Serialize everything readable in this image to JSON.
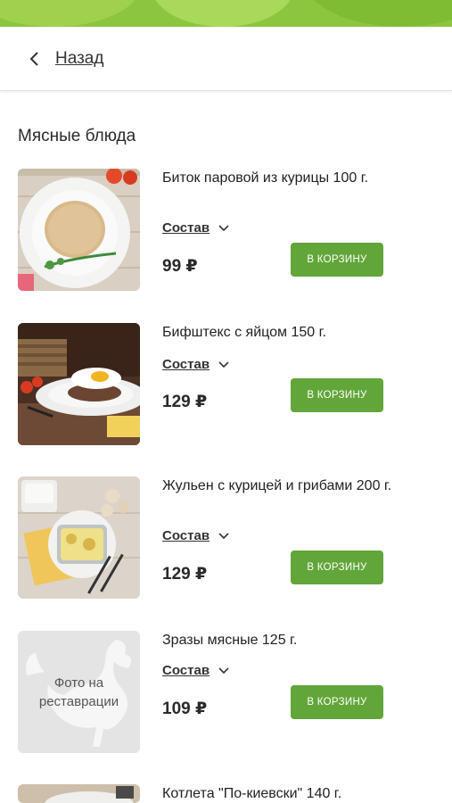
{
  "header": {
    "back_label": "Назад"
  },
  "section": {
    "title": "Мясные блюда"
  },
  "items": [
    {
      "title": "Биток паровой из курицы 100 г.",
      "composition_label": "Состав",
      "price": "99 ₽",
      "cart_label": "В КОРЗИНУ"
    },
    {
      "title": "Бифштекс с яйцом 150 г.",
      "composition_label": "Состав",
      "price": "129 ₽",
      "cart_label": "В КОРЗИНУ"
    },
    {
      "title": "Жульен с курицей и грибами 200 г.",
      "composition_label": "Состав",
      "price": "129 ₽",
      "cart_label": "В КОРЗИНУ"
    },
    {
      "title": "Зразы мясные 125 г.",
      "composition_label": "Состав",
      "price": "109 ₽",
      "cart_label": "В КОРЗИНУ",
      "placeholder_text": "Фото на реставрации"
    },
    {
      "title": "Котлета \"По-киевски\" 140 г."
    }
  ],
  "colors": {
    "accent": "#62a63a",
    "banner": "#8cc63f"
  }
}
